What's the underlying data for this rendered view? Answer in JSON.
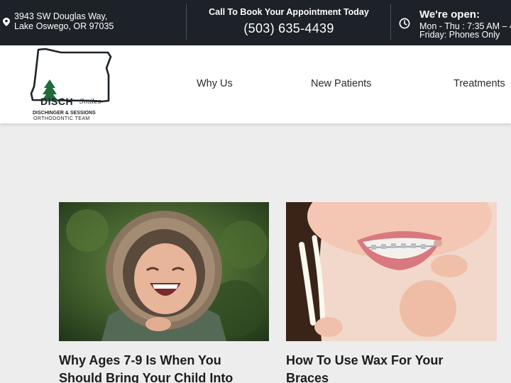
{
  "topbar": {
    "address_line1": "3943 SW Douglas Way,",
    "address_line2": "Lake Oswego, OR 97035",
    "call_label": "Call To Book Your Appointment Today",
    "phone": "(503) 635-4439",
    "hours_title": "We're open:",
    "hours_line1": "Mon - Thu : 7:35 AM – 4",
    "hours_line2": "Friday: Phones Only"
  },
  "logo": {
    "brand": "DISCH",
    "tagline": "Smiles",
    "subtitle_line1": "DISCHINGER & SESSIONS",
    "subtitle_line2": "ORTHODONTIC TEAM"
  },
  "nav": {
    "items": [
      {
        "label": "Why Us"
      },
      {
        "label": "New Patients"
      },
      {
        "label": "Treatments"
      }
    ]
  },
  "posts": [
    {
      "title_line1": "Why Ages 7-9 Is When You",
      "title_line2": "Should Bring Your Child Into"
    },
    {
      "title_line1": "How To Use Wax For Your",
      "title_line2": "Braces"
    }
  ],
  "colors": {
    "topbar_bg": "#1c2227",
    "page_bg": "#ededed",
    "logo_tree": "#1f6b3a"
  }
}
